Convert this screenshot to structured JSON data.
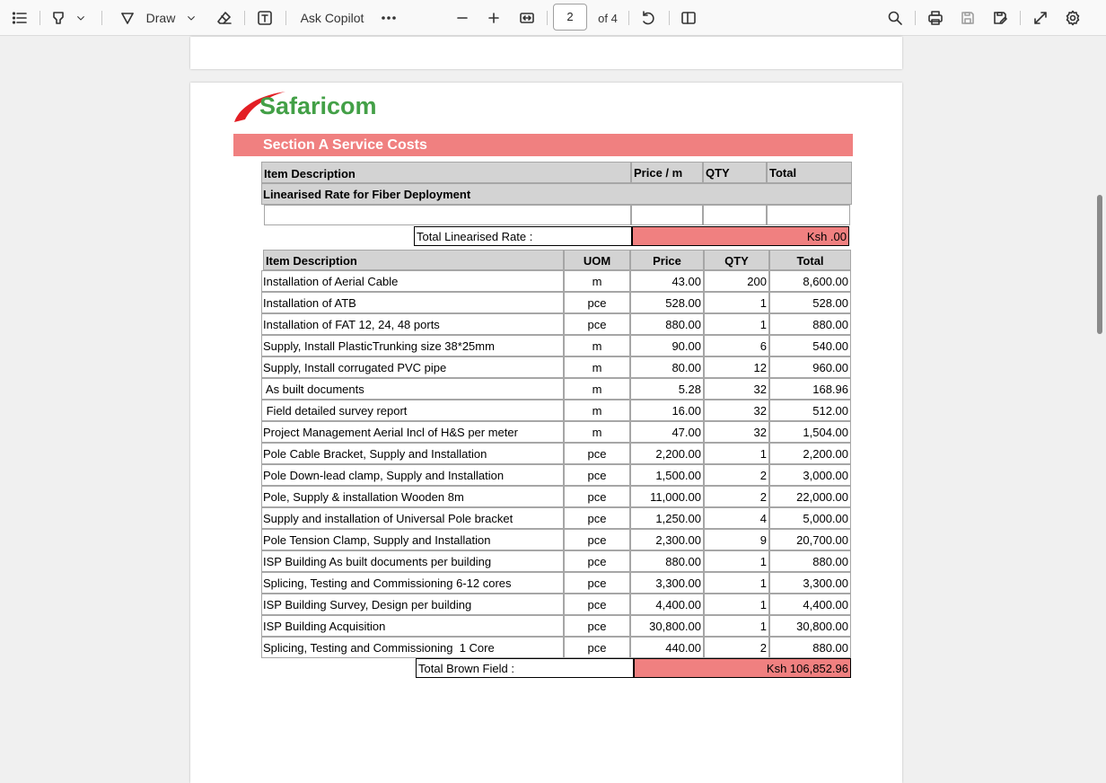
{
  "toolbar": {
    "draw_label": "Draw",
    "copilot_label": "Ask Copilot",
    "page_current": "2",
    "page_total": "of 4"
  },
  "doc": {
    "brand": "Safaricom",
    "section_title": "Section A Service Costs",
    "lin_header": {
      "item": "Item Description",
      "price": "Price / m",
      "qty": "QTY",
      "total": "Total"
    },
    "lin_row_label": "Linearised Rate for Fiber Deployment",
    "lin_total_label": "Total Linearised Rate :",
    "lin_total_value": "Ksh .00",
    "main_header": {
      "item": "Item Description",
      "uom": "UOM",
      "price": "Price",
      "qty": "QTY",
      "total": "Total"
    },
    "rows": [
      {
        "item": "Installation of Aerial Cable",
        "uom": "m",
        "price": "43.00",
        "qty": "200",
        "total": "8,600.00"
      },
      {
        "item": "Installation of ATB",
        "uom": "pce",
        "price": "528.00",
        "qty": "1",
        "total": "528.00"
      },
      {
        "item": "Installation of FAT 12, 24, 48 ports",
        "uom": "pce",
        "price": "880.00",
        "qty": "1",
        "total": "880.00"
      },
      {
        "item": "Supply, Install PlasticTrunking size 38*25mm",
        "uom": "m",
        "price": "90.00",
        "qty": "6",
        "total": "540.00"
      },
      {
        "item": "Supply, Install corrugated PVC pipe",
        "uom": "m",
        "price": "80.00",
        "qty": "12",
        "total": "960.00"
      },
      {
        "item": " As built documents",
        "uom": "m",
        "price": "5.28",
        "qty": "32",
        "total": "168.96"
      },
      {
        "item": " Field detailed survey report",
        "uom": "m",
        "price": "16.00",
        "qty": "32",
        "total": "512.00"
      },
      {
        "item": "Project Management Aerial Incl of H&S per meter",
        "uom": "m",
        "price": "47.00",
        "qty": "32",
        "total": "1,504.00"
      },
      {
        "item": "Pole Cable Bracket, Supply and Installation",
        "uom": "pce",
        "price": "2,200.00",
        "qty": "1",
        "total": "2,200.00"
      },
      {
        "item": "Pole Down-lead clamp, Supply and Installation",
        "uom": "pce",
        "price": "1,500.00",
        "qty": "2",
        "total": "3,000.00"
      },
      {
        "item": "Pole, Supply & installation Wooden 8m",
        "uom": "pce",
        "price": "11,000.00",
        "qty": "2",
        "total": "22,000.00"
      },
      {
        "item": "Supply and installation of Universal Pole bracket",
        "uom": "pce",
        "price": "1,250.00",
        "qty": "4",
        "total": "5,000.00"
      },
      {
        "item": "Pole Tension Clamp, Supply and Installation",
        "uom": "pce",
        "price": "2,300.00",
        "qty": "9",
        "total": "20,700.00"
      },
      {
        "item": "ISP Building As built documents per building",
        "uom": "pce",
        "price": "880.00",
        "qty": "1",
        "total": "880.00"
      },
      {
        "item": "Splicing, Testing and Commissioning 6-12 cores",
        "uom": "pce",
        "price": "3,300.00",
        "qty": "1",
        "total": "3,300.00"
      },
      {
        "item": "ISP Building Survey, Design per building",
        "uom": "pce",
        "price": "4,400.00",
        "qty": "1",
        "total": "4,400.00"
      },
      {
        "item": "ISP Building Acquisition",
        "uom": "pce",
        "price": "30,800.00",
        "qty": "1",
        "total": "30,800.00"
      },
      {
        "item": "Splicing, Testing and Commissioning  1 Core",
        "uom": "pce",
        "price": "440.00",
        "qty": "2",
        "total": "880.00"
      }
    ],
    "brown_total_label": "Total Brown Field :",
    "brown_total_value": "Ksh 106,852.96"
  }
}
